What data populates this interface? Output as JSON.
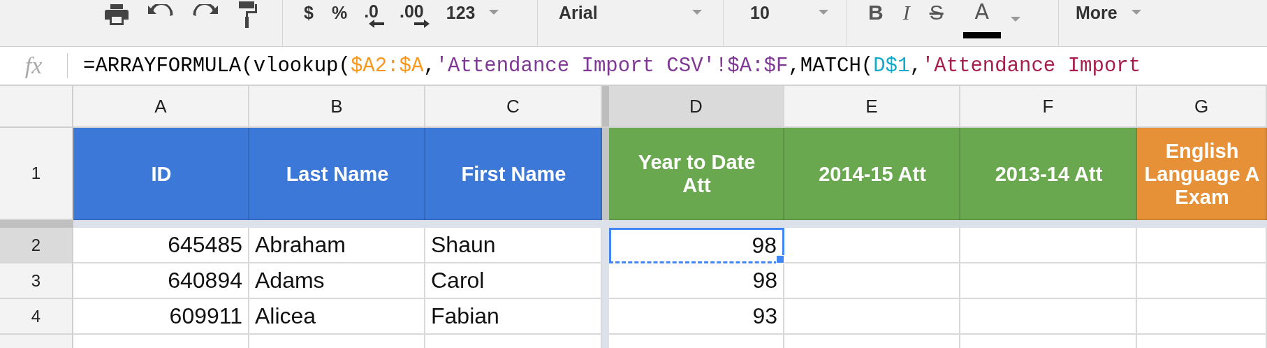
{
  "toolbar": {
    "groups": [
      [
        {
          "kind": "print"
        },
        {
          "kind": "undo"
        },
        {
          "kind": "redo"
        },
        {
          "kind": "paint-format"
        }
      ],
      [
        {
          "kind": "plain",
          "label": "$"
        },
        {
          "kind": "plain",
          "label": "%"
        },
        {
          "kind": "decimal-less",
          "label": ".0"
        },
        {
          "kind": "decimal-more",
          "label": ".00"
        },
        {
          "kind": "menu",
          "label": "123"
        }
      ],
      [
        {
          "kind": "wide-menu",
          "label": "Arial"
        }
      ],
      [
        {
          "kind": "wide-menu",
          "label": "10"
        }
      ],
      [
        {
          "kind": "bold",
          "label": "B"
        },
        {
          "kind": "italic",
          "label": "I"
        },
        {
          "kind": "strike",
          "label": "S"
        },
        {
          "kind": "text-color",
          "label": "A",
          "color": "#000000"
        }
      ],
      [
        {
          "kind": "menu",
          "label": "More"
        }
      ]
    ]
  },
  "formula_bar": {
    "label": "fx",
    "tokens": [
      {
        "text": "=ARRAYFORMULA(vlookup(",
        "color": "#000000"
      },
      {
        "text": "$A2:$A",
        "color": "#f7981d"
      },
      {
        "text": ",",
        "color": "#000000"
      },
      {
        "text": "'Attendance Import CSV'!$A:$F",
        "color": "#7e3794"
      },
      {
        "text": ",MATCH(",
        "color": "#000000"
      },
      {
        "text": "D$1",
        "color": "#11a9cc"
      },
      {
        "text": ",",
        "color": "#000000"
      },
      {
        "text": "'Attendance Import",
        "color": "#a61d4c"
      }
    ]
  },
  "sheet": {
    "columns": [
      {
        "letter": "A",
        "selected": false
      },
      {
        "letter": "B",
        "selected": false
      },
      {
        "letter": "C",
        "selected": false
      },
      {
        "letter": "D",
        "selected": true
      },
      {
        "letter": "E",
        "selected": false
      },
      {
        "letter": "F",
        "selected": false
      },
      {
        "letter": "G",
        "selected": false
      }
    ],
    "header_row": {
      "number": "1",
      "selected": false,
      "cells": [
        {
          "text": "ID",
          "color": "#3c78d8"
        },
        {
          "text": "Last Name",
          "color": "#3c78d8"
        },
        {
          "text": "First Name",
          "color": "#3c78d8"
        },
        {
          "text": "Year to Date Att",
          "color": "#6aa84f"
        },
        {
          "text": "2014-15 Att",
          "color": "#6aa84f"
        },
        {
          "text": "2013-14 Att",
          "color": "#6aa84f"
        },
        {
          "text": "English Language A Exam",
          "color": "#e69138"
        }
      ]
    },
    "rows": [
      {
        "number": "2",
        "selected": true,
        "cells": [
          {
            "kind": "number",
            "text": "645485",
            "selected": false
          },
          {
            "kind": "text",
            "text": "Abraham",
            "selected": false
          },
          {
            "kind": "text",
            "text": "Shaun",
            "selected": false
          },
          {
            "kind": "number",
            "text": "98",
            "selected": true
          },
          {
            "kind": "empty",
            "selected": false
          },
          {
            "kind": "empty",
            "selected": false
          },
          {
            "kind": "empty",
            "selected": false
          }
        ]
      },
      {
        "number": "3",
        "selected": false,
        "cells": [
          {
            "kind": "number",
            "text": "640894",
            "selected": false
          },
          {
            "kind": "text",
            "text": "Adams",
            "selected": false
          },
          {
            "kind": "text",
            "text": "Carol",
            "selected": false
          },
          {
            "kind": "number",
            "text": "98",
            "selected": false
          },
          {
            "kind": "empty",
            "selected": false
          },
          {
            "kind": "empty",
            "selected": false
          },
          {
            "kind": "empty",
            "selected": false
          }
        ]
      },
      {
        "number": "4",
        "selected": false,
        "cells": [
          {
            "kind": "number",
            "text": "609911",
            "selected": false
          },
          {
            "kind": "text",
            "text": "Alicea",
            "selected": false
          },
          {
            "kind": "text",
            "text": "Fabian",
            "selected": false
          },
          {
            "kind": "number",
            "text": "93",
            "selected": false
          },
          {
            "kind": "empty",
            "selected": false
          },
          {
            "kind": "empty",
            "selected": false
          },
          {
            "kind": "empty",
            "selected": false
          }
        ]
      }
    ]
  }
}
